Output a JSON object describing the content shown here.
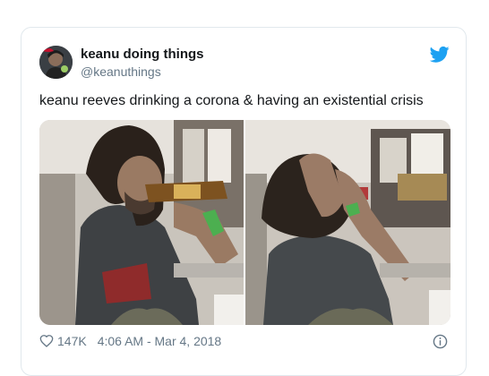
{
  "tweet": {
    "display_name": "keanu doing things",
    "handle": "@keanuthings",
    "text": "keanu reeves drinking a corona & having an existential crisis",
    "likes": "147K",
    "timestamp": "4:06 AM - Mar 4, 2018",
    "media": [
      {
        "label": "photo-drinking"
      },
      {
        "label": "photo-crisis"
      }
    ]
  },
  "colors": {
    "brand": "#1da1f2",
    "text_primary": "#14171a",
    "text_secondary": "#657786",
    "border": "#e1e8ed"
  },
  "icons": {
    "brand": "twitter-bird-icon",
    "like": "heart-icon",
    "info": "info-icon"
  }
}
